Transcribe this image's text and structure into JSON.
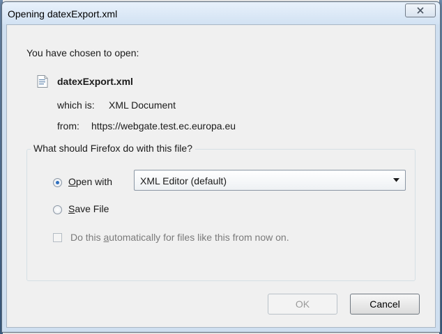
{
  "window": {
    "title": "Opening datexExport.xml"
  },
  "info": {
    "intro": "You have chosen to open:",
    "file_name": "datexExport.xml",
    "which_label": "which is:",
    "which_value": "XML Document",
    "from_label": "from:",
    "from_value": "https://webgate.test.ec.europa.eu"
  },
  "group": {
    "legend": "What should Firefox do with this file?",
    "open_with": {
      "first": "O",
      "rest": "pen with",
      "selected": true
    },
    "app_select": {
      "value": "XML Editor (default)"
    },
    "save_file": {
      "first": "S",
      "rest": "ave File",
      "selected": false
    },
    "auto": {
      "pre": "Do this ",
      "underlined": "a",
      "post": "utomatically for files like this from now on.",
      "checked": false,
      "disabled": true
    }
  },
  "buttons": {
    "ok": "OK",
    "cancel": "Cancel"
  },
  "icons": {
    "close": "close-icon",
    "file": "xml-file-icon",
    "dropdown": "chevron-down-icon"
  },
  "colors": {
    "accent": "#2f6fbf",
    "dialog_bg": "#f0f0f0",
    "title_bar": "#d2e2f3"
  }
}
